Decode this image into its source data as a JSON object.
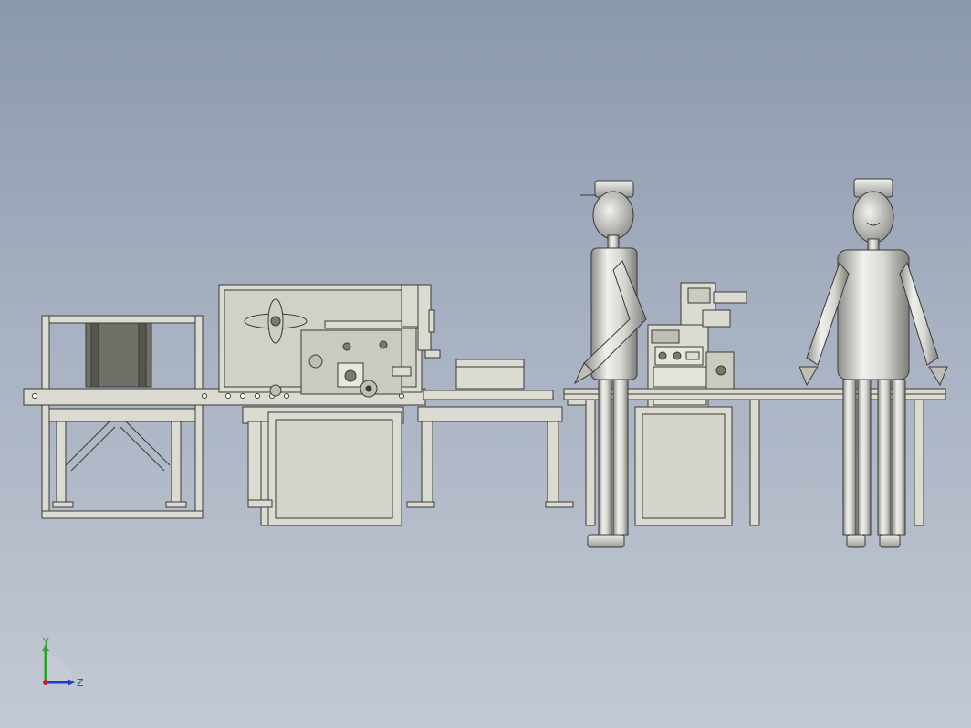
{
  "viewport": {
    "background_top": "#8a98ad",
    "background_bottom": "#c3c9d4"
  },
  "triad": {
    "y_label": "Y",
    "z_label": "Z",
    "y_color": "#2aa12a",
    "z_color": "#1f3fc4",
    "origin_color": "#d01f1f"
  },
  "colors": {
    "machine_fill": "#dcdbd2",
    "machine_stroke": "#3a3a36",
    "figure_metal_light": "#e6e6e2",
    "figure_metal_dark": "#8c8c88"
  }
}
